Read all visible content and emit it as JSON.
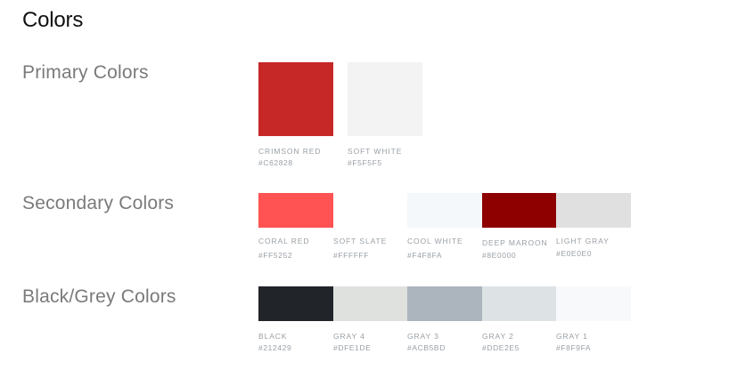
{
  "title": "Colors",
  "sections": [
    {
      "label": "Primary Colors",
      "swatches": [
        {
          "name": "CRIMSON RED",
          "hex": "#C62828",
          "color": "#C62828"
        },
        {
          "name": "SOFT WHITE",
          "hex": "#F5F5F5",
          "color": "#F3F3F3"
        }
      ]
    },
    {
      "label": "Secondary Colors",
      "swatches": [
        {
          "name": "CORAL RED",
          "hex": "#FF5252",
          "color": "#FF5252"
        },
        {
          "name": "SOFT SLATE",
          "hex": "#FFFFFF",
          "color": "#FFFFFF"
        },
        {
          "name": "COOL WHITE",
          "hex": "#F4F8FA",
          "color": "#F4F8FA"
        },
        {
          "name": "DEEP MAROON",
          "hex": "#8E0000",
          "color": "#8E0000"
        },
        {
          "name": "LIGHT GRAY",
          "hex": "#E0E0E0",
          "color": "#E0E0E0"
        }
      ]
    },
    {
      "label": "Black/Grey Colors",
      "swatches": [
        {
          "name": "BLACK",
          "hex": "#212429",
          "color": "#212429"
        },
        {
          "name": "GRAY 4",
          "hex": "#DFE1DE",
          "color": "#DFE1DE"
        },
        {
          "name": "GRAY 3",
          "hex": "#ACB5BD",
          "color": "#ACB5BD"
        },
        {
          "name": "GRAY 2",
          "hex": "#DDE2E5",
          "color": "#DDE2E5"
        },
        {
          "name": "GRAY 1",
          "hex": "#F8F9FA",
          "color": "#F8F9FA"
        }
      ]
    }
  ]
}
